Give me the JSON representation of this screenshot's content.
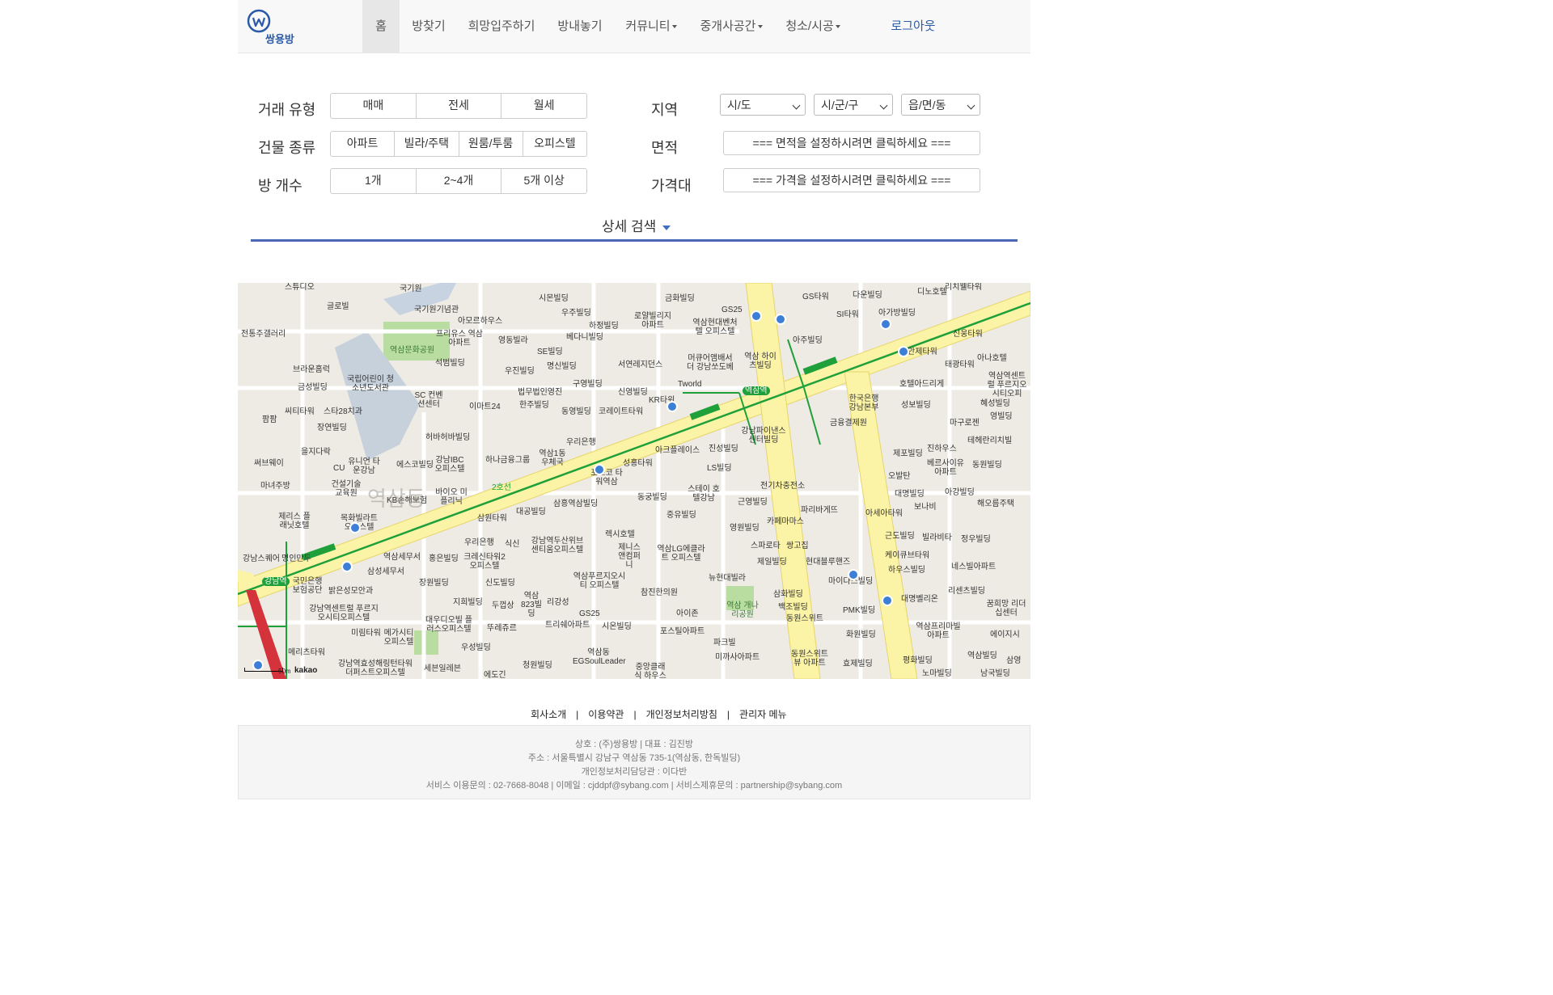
{
  "logo": {
    "text": "쌍용방"
  },
  "nav": {
    "items": [
      {
        "label": "홈",
        "dropdown": false
      },
      {
        "label": "방찾기",
        "dropdown": false
      },
      {
        "label": "희망입주하기",
        "dropdown": false
      },
      {
        "label": "방내놓기",
        "dropdown": false
      },
      {
        "label": "커뮤니티",
        "dropdown": true
      },
      {
        "label": "중개사공간",
        "dropdown": true
      },
      {
        "label": "청소/시공",
        "dropdown": true
      }
    ],
    "logout": "로그아웃"
  },
  "search": {
    "trade_label": "거래 유형",
    "trade_options": [
      "매매",
      "전세",
      "월세"
    ],
    "building_label": "건물 종류",
    "building_options": [
      "아파트",
      "빌라/주택",
      "원룸/투룸",
      "오피스텔"
    ],
    "rooms_label": "방 개수",
    "rooms_options": [
      "1개",
      "2~4개",
      "5개 이상"
    ],
    "region_label": "지역",
    "region_selects": [
      "시/도",
      "시/군/구",
      "읍/면/동"
    ],
    "area_label": "면적",
    "area_button": "=== 면적을 설정하시려면 클릭하세요 ===",
    "price_label": "가격대",
    "price_button": "=== 가격을 설정하시려면 클릭하세요 ===",
    "detail_search": "상세 검색"
  },
  "map": {
    "labels": {
      "l1": "국기원",
      "l2": "국기원기념관",
      "l3": "아모르하우스",
      "l4": "역삼문화공원",
      "l5": "프리유스 역삼아파트",
      "l6": "영동빌라",
      "l7": "시몬빌딩",
      "l8": "우주빌딩",
      "l9": "하정빌딩",
      "l10": "로얄빌리지 아파트",
      "l11": "금화빌딩",
      "l12": "GS25",
      "l13": "역삼현대벤처텔 오피스텔",
      "l14": "GS타워",
      "l15": "다운빌딩",
      "l16": "디노호텔",
      "l17": "리치웰타워",
      "l18": "아가방빌딩",
      "l19": "SI타워",
      "l20": "아주빌딩",
      "l21": "신웅타워",
      "l22": "안제타워",
      "l23": "태광타워",
      "l24": "아나호텔",
      "l25": "호텔아드리게",
      "l26": "역삼역센트럴 푸르지오시티오피",
      "l27": "한국은행 강남본부",
      "l28": "성보빌딩",
      "l29": "혜성빌딩",
      "l30": "마구로젠",
      "l31": "영빌딩",
      "l32": "금융결제원",
      "l33": "테헤란리치빌",
      "l34": "진하우스",
      "l35": "제포빌딩",
      "l36": "베르사이유 아파트",
      "l37": "동원빌딩",
      "l38": "오발탄",
      "l39": "대명빌딩",
      "l40": "아강빌딩",
      "l41": "보나비",
      "l42": "해오름주택",
      "l43": "아세아타워",
      "l44": "근도빌딩",
      "l45": "빌라비타",
      "l46": "정우빌딩",
      "l47": "케이큐브타워",
      "l48": "하우스빌딩",
      "l49": "네스빌아파트",
      "l50": "마이다스빌딩",
      "l51": "리센츠빌딩",
      "l52": "대명벨리온",
      "l53": "꿈희망 리더십센터",
      "l54": "PMK빌딩",
      "l55": "화원빌딩",
      "l56": "역삼프리마빌 아파트",
      "l57": "에이지시",
      "l58": "평화빌딩",
      "l59": "역삼빌딩",
      "l60": "노마빌딩",
      "l61": "삼영",
      "l62": "남국빌딩",
      "l63": "전통주갤러리",
      "l64": "브라운홈럭",
      "l65": "국립어린이 청소년도서관",
      "l66": "금성빌딩",
      "l67": "씨티타워",
      "l68": "스타28치과",
      "l69": "팜팜",
      "l70": "장연빌딩",
      "l71": "SC 컨벤션센터",
      "l72": "석범빌딩",
      "l73": "우진빌딩",
      "l74": "SE빌딩",
      "l75": "명신빌딩",
      "l76": "베다니빌딩",
      "l77": "서연레지던스",
      "l78": "머큐어앰배서더 강남쏘도베",
      "l79": "역삼 하이츠빌딩",
      "l80": "Tworld",
      "l81": "구영빌딩",
      "l82": "법무법인영진",
      "l83": "한주빌딩",
      "l84": "이마트24",
      "l85": "신영빌딩",
      "l86": "KR타워",
      "l87": "동영빌딩",
      "l88": "코레이트타워",
      "l89": "우리은행",
      "l90": "허바허바빌딩",
      "l91": "을지다락",
      "l92": "써브웨이",
      "l93": "유니언 타운강남",
      "l94": "CU",
      "l95": "에스코빌딩",
      "l96": "강남IBC 오피스텔",
      "l97": "하나금융그룹",
      "l98": "역삼1동 우체국",
      "l99": "포스코 타워역삼",
      "l100": "아크플레이스",
      "l101": "진성빌딩",
      "l102": "강남파이낸스 센터빌딩",
      "l103": "LS빌딩",
      "l104": "성홍타워",
      "l105": "마녀주방",
      "l106": "건설기술 교육원",
      "l107": "KB손해보험",
      "l108": "바이오 미플리닉",
      "l109": "스테이 호텔강남",
      "l110": "동궁빌딩",
      "l111": "전기차충전소",
      "l112": "근영빌딩",
      "l113": "파리바게뜨",
      "l114": "제리스 플래닛호텔",
      "l115": "목화빌라트 오피스텔",
      "l116": "삼원타워",
      "l117": "대공빌딩",
      "l118": "삼흥역삼빌딩",
      "l119": "중유빌딩",
      "l120": "카페마마스",
      "l121": "스파로타",
      "l122": "쌍고집",
      "l123": "영원빌딩",
      "l124": "제일빌딩",
      "l125": "현대블루핸즈",
      "l126": "렉시호텔",
      "l127": "제니스 앤컴퍼니",
      "l128": "역삼LG에클라트 오피스텔",
      "l129": "강남역두산위브 센티움오피스텔",
      "l130": "우리은행",
      "l131": "식신",
      "l132": "강남스퀘어",
      "l133": "명인만두",
      "l134": "역삼세무서",
      "l135": "홍은빌딩",
      "l136": "크레신타워2 오피스텔",
      "l137": "삼성세무서",
      "l138": "장원빌딩",
      "l139": "신도빌딩",
      "l140": "역삼푸르지오시티 오피스텔",
      "l141": "뉴현대빌라",
      "l142": "참진한의원",
      "l143": "삼화빌딩",
      "l144": "백조빌딩",
      "l145": "동원스위트",
      "l146": "국민은행 보험공단",
      "l147": "밝은성모안과",
      "l148": "두껍상",
      "l149": "역삼 823빌딩",
      "l150": "리강성",
      "l151": "GS25",
      "l152": "역삼 개나리공원",
      "l153": "아이존",
      "l154": "포스틸아파트",
      "l155": "강남역센트럴 푸르지오시티오피스텔",
      "l156": "지희빌딩",
      "l157": "대우디오빌 플러스오피스텔",
      "l158": "뚜레쥬르",
      "l159": "트리쉐아파트",
      "l160": "시온빌딩",
      "l161": "미림타워",
      "l162": "메가시티 오피스텔",
      "l163": "우성빌딩",
      "l164": "파크빌",
      "l165": "미까사아파트",
      "l166": "동원스위트뷰 아파트",
      "l167": "효제빌딩",
      "l168": "메리츠타워",
      "l169": "강남역효성해링턴타워 더퍼스트오피스텔",
      "l170": "세븐일레븐",
      "l171": "청원빌딩",
      "l172": "역삼동 EGSoulLeader",
      "l173": "중앙클래식 하우스5차",
      "l174": "에도긴",
      "l175": "스튜디오",
      "l176": "글로빌",
      "l177": "강남역",
      "l178": "역삼역",
      "l179": "역삼동",
      "l180": "2호선"
    },
    "kakao": "kakao",
    "scale": "50m"
  },
  "footer": {
    "links": [
      "회사소개",
      "이용약관",
      "개인정보처리방침",
      "관리자 메뉴"
    ],
    "separator": "|",
    "line1": "상호 : (주)쌍용방 | 대표 : 김진방",
    "line2": "주소 : 서울특별시 강남구 역삼동 735-1(역삼동, 한독빌딩)",
    "line3": "개인정보처리담당관 : 이다반",
    "line4": "서비스 이용문의 : 02-7668-8048 | 이메일 : cjddpf@sybang.com | 서비스제휴문의 : partnership@sybang.com"
  },
  "colors": {
    "accent": "#2b5ba8",
    "divider": "#4a66b7",
    "subway_line2": "#1fa03a",
    "subway_sinbundang": "#d4333b",
    "road_major": "#fbf3a6"
  }
}
